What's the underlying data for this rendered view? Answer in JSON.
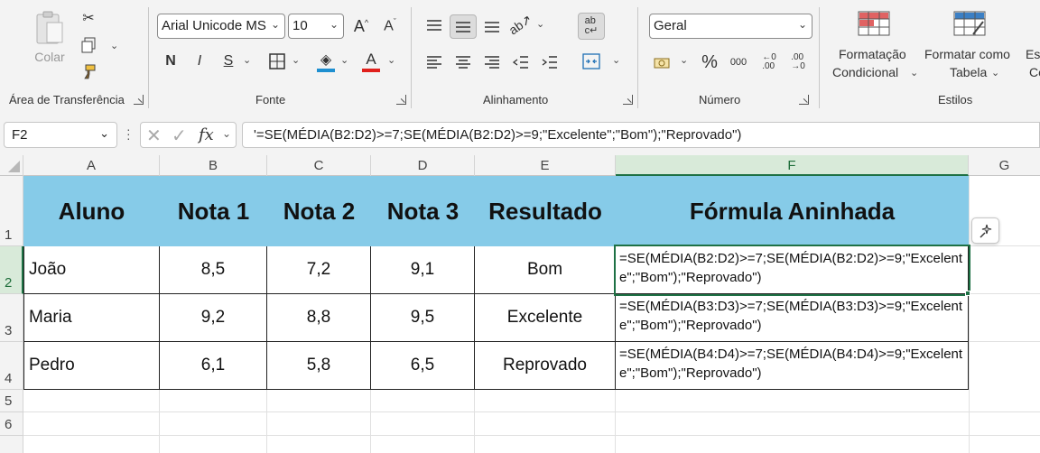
{
  "ribbon": {
    "clipboard": {
      "paste_label": "Colar",
      "group_label": "Área de Transferência"
    },
    "font": {
      "font_name": "Arial Unicode MS",
      "font_size": "10",
      "bold": "N",
      "italic": "I",
      "underline": "S",
      "group_label": "Fonte"
    },
    "alignment": {
      "group_label": "Alinhamento"
    },
    "number": {
      "format": "Geral",
      "percent": "%",
      "thousands": "000",
      "group_label": "Número"
    },
    "styles": {
      "cond_format_line1": "Formatação",
      "cond_format_line2": "Condicional",
      "format_table_line1": "Formatar como",
      "format_table_line2": "Tabela",
      "cell_styles_line1": "Est",
      "cell_styles_line2": "Cé",
      "group_label": "Estilos"
    },
    "accent": "#1e7145"
  },
  "formula_bar": {
    "name_box": "F2",
    "fx": "fx",
    "formula": "'=SE(MÉDIA(B2:D2)>=7;SE(MÉDIA(B2:D2)>=9;\"Excelente\";\"Bom\");\"Reprovado\")"
  },
  "columns": [
    "A",
    "B",
    "C",
    "D",
    "E",
    "F",
    "G"
  ],
  "rows": [
    "1",
    "2",
    "3",
    "4",
    "5",
    "6"
  ],
  "table": {
    "headers": [
      "Aluno",
      "Nota 1",
      "Nota 2",
      "Nota 3",
      "Resultado",
      "Fórmula Aninhada"
    ],
    "header_fill": "#86cbe8",
    "rows": [
      {
        "aluno": "João",
        "n1": "8,5",
        "n2": "7,2",
        "n3": "9,1",
        "resultado": "Bom",
        "formula": "=SE(MÉDIA(B2:D2)>=7;SE(MÉDIA(B2:D2)>=9;\"Excelente\";\"Bom\");\"Reprovado\")"
      },
      {
        "aluno": "Maria",
        "n1": "9,2",
        "n2": "8,8",
        "n3": "9,5",
        "resultado": "Excelente",
        "formula": "=SE(MÉDIA(B3:D3)>=7;SE(MÉDIA(B3:D3)>=9;\"Excelente\";\"Bom\");\"Reprovado\")"
      },
      {
        "aluno": "Pedro",
        "n1": "6,1",
        "n2": "5,8",
        "n3": "6,5",
        "resultado": "Reprovado",
        "formula": "=SE(MÉDIA(B4:D4)>=7;SE(MÉDIA(B4:D4)>=9;\"Excelente\";\"Bom\");\"Reprovado\")"
      }
    ]
  }
}
